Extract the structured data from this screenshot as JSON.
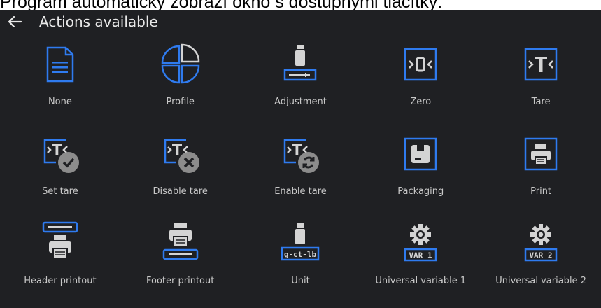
{
  "caption": "Program automaticky zobrazí okno s dostupnými tlačítky:",
  "header": {
    "title": "Actions available",
    "back_icon": "arrow-left-icon"
  },
  "colors": {
    "accent": "#2f7bef",
    "background": "#1f2023",
    "icon_gray": "#d4d4d4",
    "badge_gray": "#8c8c8c"
  },
  "actions": [
    {
      "label": "None",
      "icon": "document-icon"
    },
    {
      "label": "Profile",
      "icon": "profile-pie-icon"
    },
    {
      "label": "Adjustment",
      "icon": "adjustment-weight-icon"
    },
    {
      "label": "Zero",
      "icon": "zero-icon"
    },
    {
      "label": "Tare",
      "icon": "tare-icon"
    },
    {
      "label": "Set tare",
      "icon": "set-tare-icon"
    },
    {
      "label": "Disable tare",
      "icon": "disable-tare-icon"
    },
    {
      "label": "Enable tare",
      "icon": "enable-tare-icon"
    },
    {
      "label": "Packaging",
      "icon": "packaging-icon"
    },
    {
      "label": "Print",
      "icon": "printer-icon"
    },
    {
      "label": "Header printout",
      "icon": "header-printout-icon"
    },
    {
      "label": "Footer printout",
      "icon": "footer-printout-icon"
    },
    {
      "label": "Unit",
      "icon": "unit-icon",
      "icon_text": "g-ct-lb"
    },
    {
      "label": "Universal variable 1",
      "icon": "universal-variable-icon",
      "icon_text": "VAR 1"
    },
    {
      "label": "Universal variable 2",
      "icon": "universal-variable-icon",
      "icon_text": "VAR 2"
    }
  ]
}
